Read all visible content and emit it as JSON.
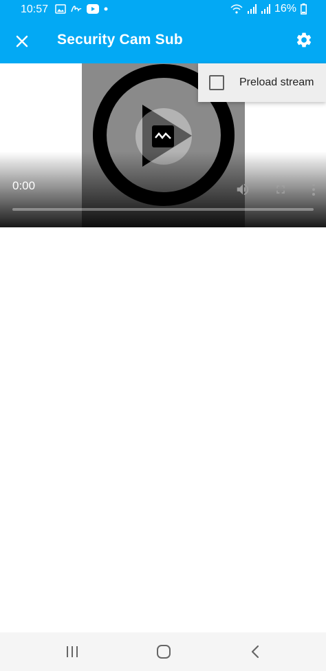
{
  "status_bar": {
    "time": "10:57",
    "battery": "16%",
    "icons": [
      "gallery-icon",
      "signature-icon",
      "youtube-icon",
      "dot-icon",
      "wifi-icon",
      "signal-icon",
      "signal-icon-2",
      "battery-icon"
    ]
  },
  "app_bar": {
    "title": "Security Cam Sub",
    "close_icon": "close-icon",
    "settings_icon": "gear-icon",
    "color": "#03a9f4"
  },
  "video": {
    "current_time": "0:00",
    "progress_fraction": 0,
    "icons": [
      "play-icon",
      "broken-image-icon",
      "volume-icon",
      "fullscreen-icon",
      "more-vert-icon"
    ]
  },
  "menu": {
    "preload_label": "Preload stream",
    "preload_checked": false
  },
  "nav_bar": {
    "icons": [
      "recents-icon",
      "home-icon",
      "back-icon"
    ]
  }
}
